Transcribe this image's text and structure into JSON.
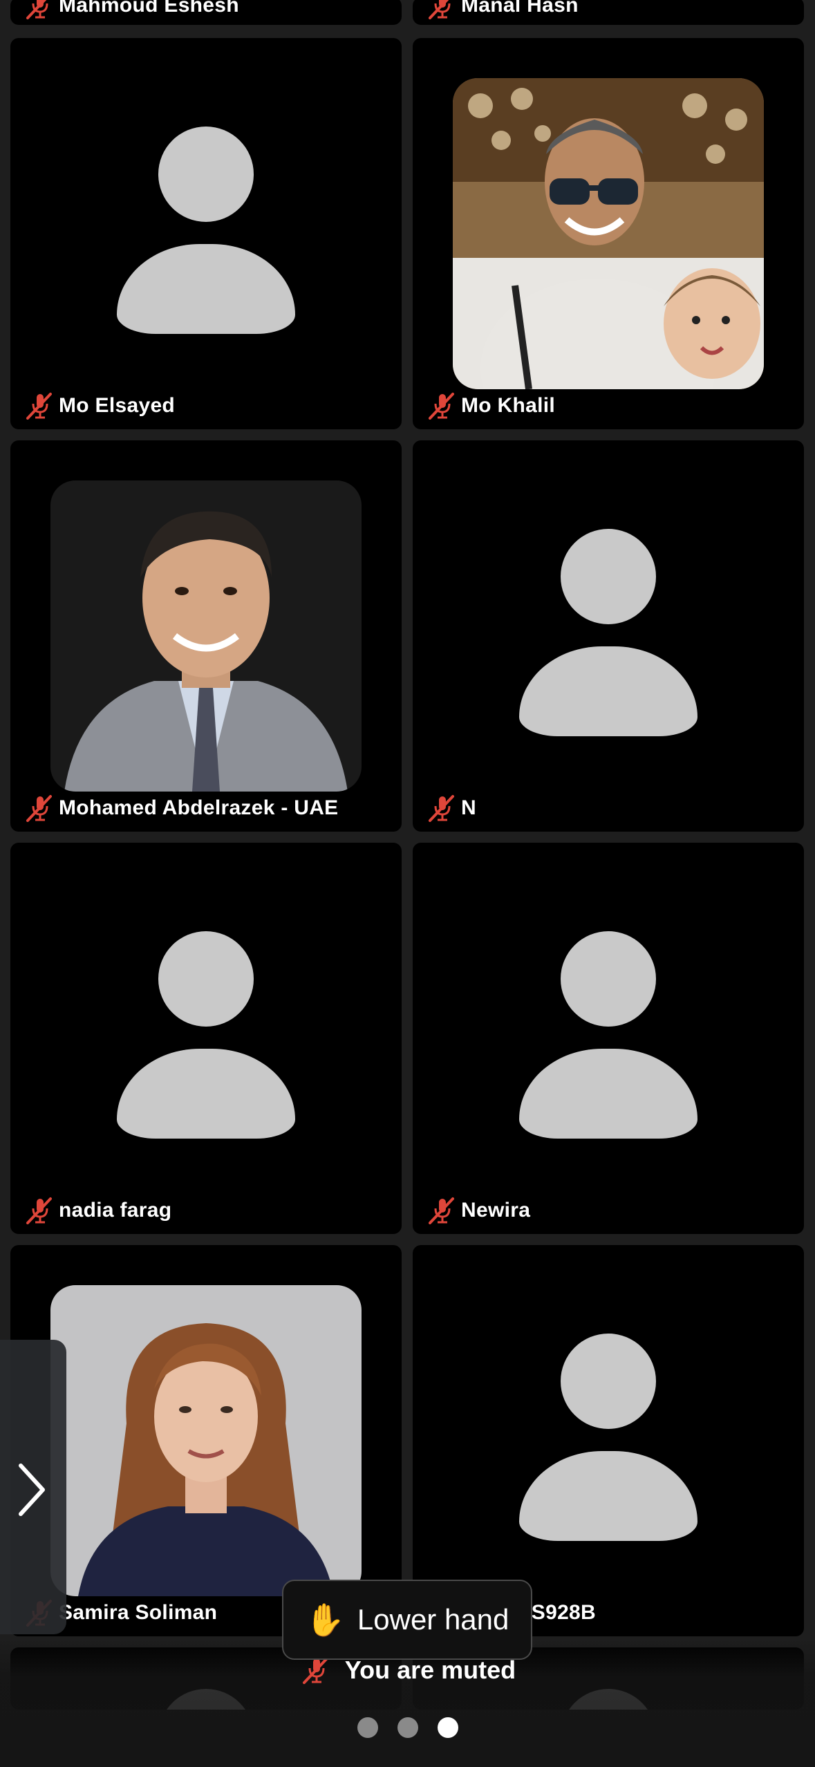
{
  "participants": [
    {
      "name": "Mahmoud Eshesh"
    },
    {
      "name": "Manal Hasn"
    },
    {
      "name": "Mo Elsayed"
    },
    {
      "name": "Mo Khalil"
    },
    {
      "name": "Mohamed Abdelrazek - UAE"
    },
    {
      "name": "N"
    },
    {
      "name": "nadia farag"
    },
    {
      "name": "Newira"
    },
    {
      "name": "Samira Soliman"
    },
    {
      "name": "ng SM-S928B"
    }
  ],
  "controls": {
    "lower_hand_label": "Lower hand",
    "hand_emoji": "✋",
    "muted_status": "You are muted"
  },
  "pagination": {
    "pages": 3,
    "current": 3
  },
  "colors": {
    "tile_bg": "#000000",
    "avatar_gray": "#c9c9c9",
    "muted_red": "#e0463a"
  },
  "icons": {
    "muted_mic": "mic-muted-icon",
    "next_page": "chevron-right-icon",
    "raise_hand": "hand-icon"
  }
}
